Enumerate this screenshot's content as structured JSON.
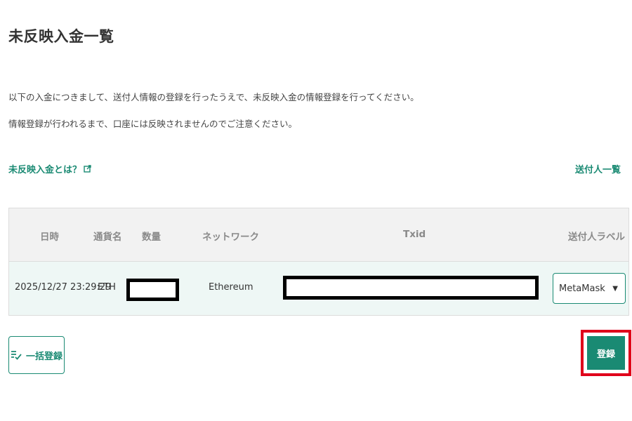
{
  "page": {
    "title": "未反映入金一覧",
    "description_line1": "以下の入金につきまして、送付人情報の登録を行ったうえで、未反映入金の情報登録を行ってください。",
    "description_line2": "情報登録が行われるまで、口座には反映されませんのでご注意ください。"
  },
  "links": {
    "help_label": "未反映入金とは？",
    "senders_label": "送付人一覧"
  },
  "table": {
    "headers": [
      "日時",
      "通貨名",
      "数量",
      "ネットワーク",
      "Txid",
      "送付人ラベル"
    ],
    "rows": [
      {
        "datetime": "2025/12/27 23:29:29",
        "currency": "ETH",
        "amount": "",
        "network": "Ethereum",
        "txid": "",
        "sender_label": "MetaMask"
      }
    ]
  },
  "buttons": {
    "bulk_register_label": "一括登録",
    "register_label": "登録"
  },
  "icons": {
    "help": "external-link-icon",
    "bulk": "list-check-icon",
    "select": "caret-down-icon"
  },
  "colors": {
    "accent": "#1a8a73",
    "highlight": "#e0001b",
    "header_bg": "#f2f2f2",
    "row_bg": "#eef7f5"
  }
}
